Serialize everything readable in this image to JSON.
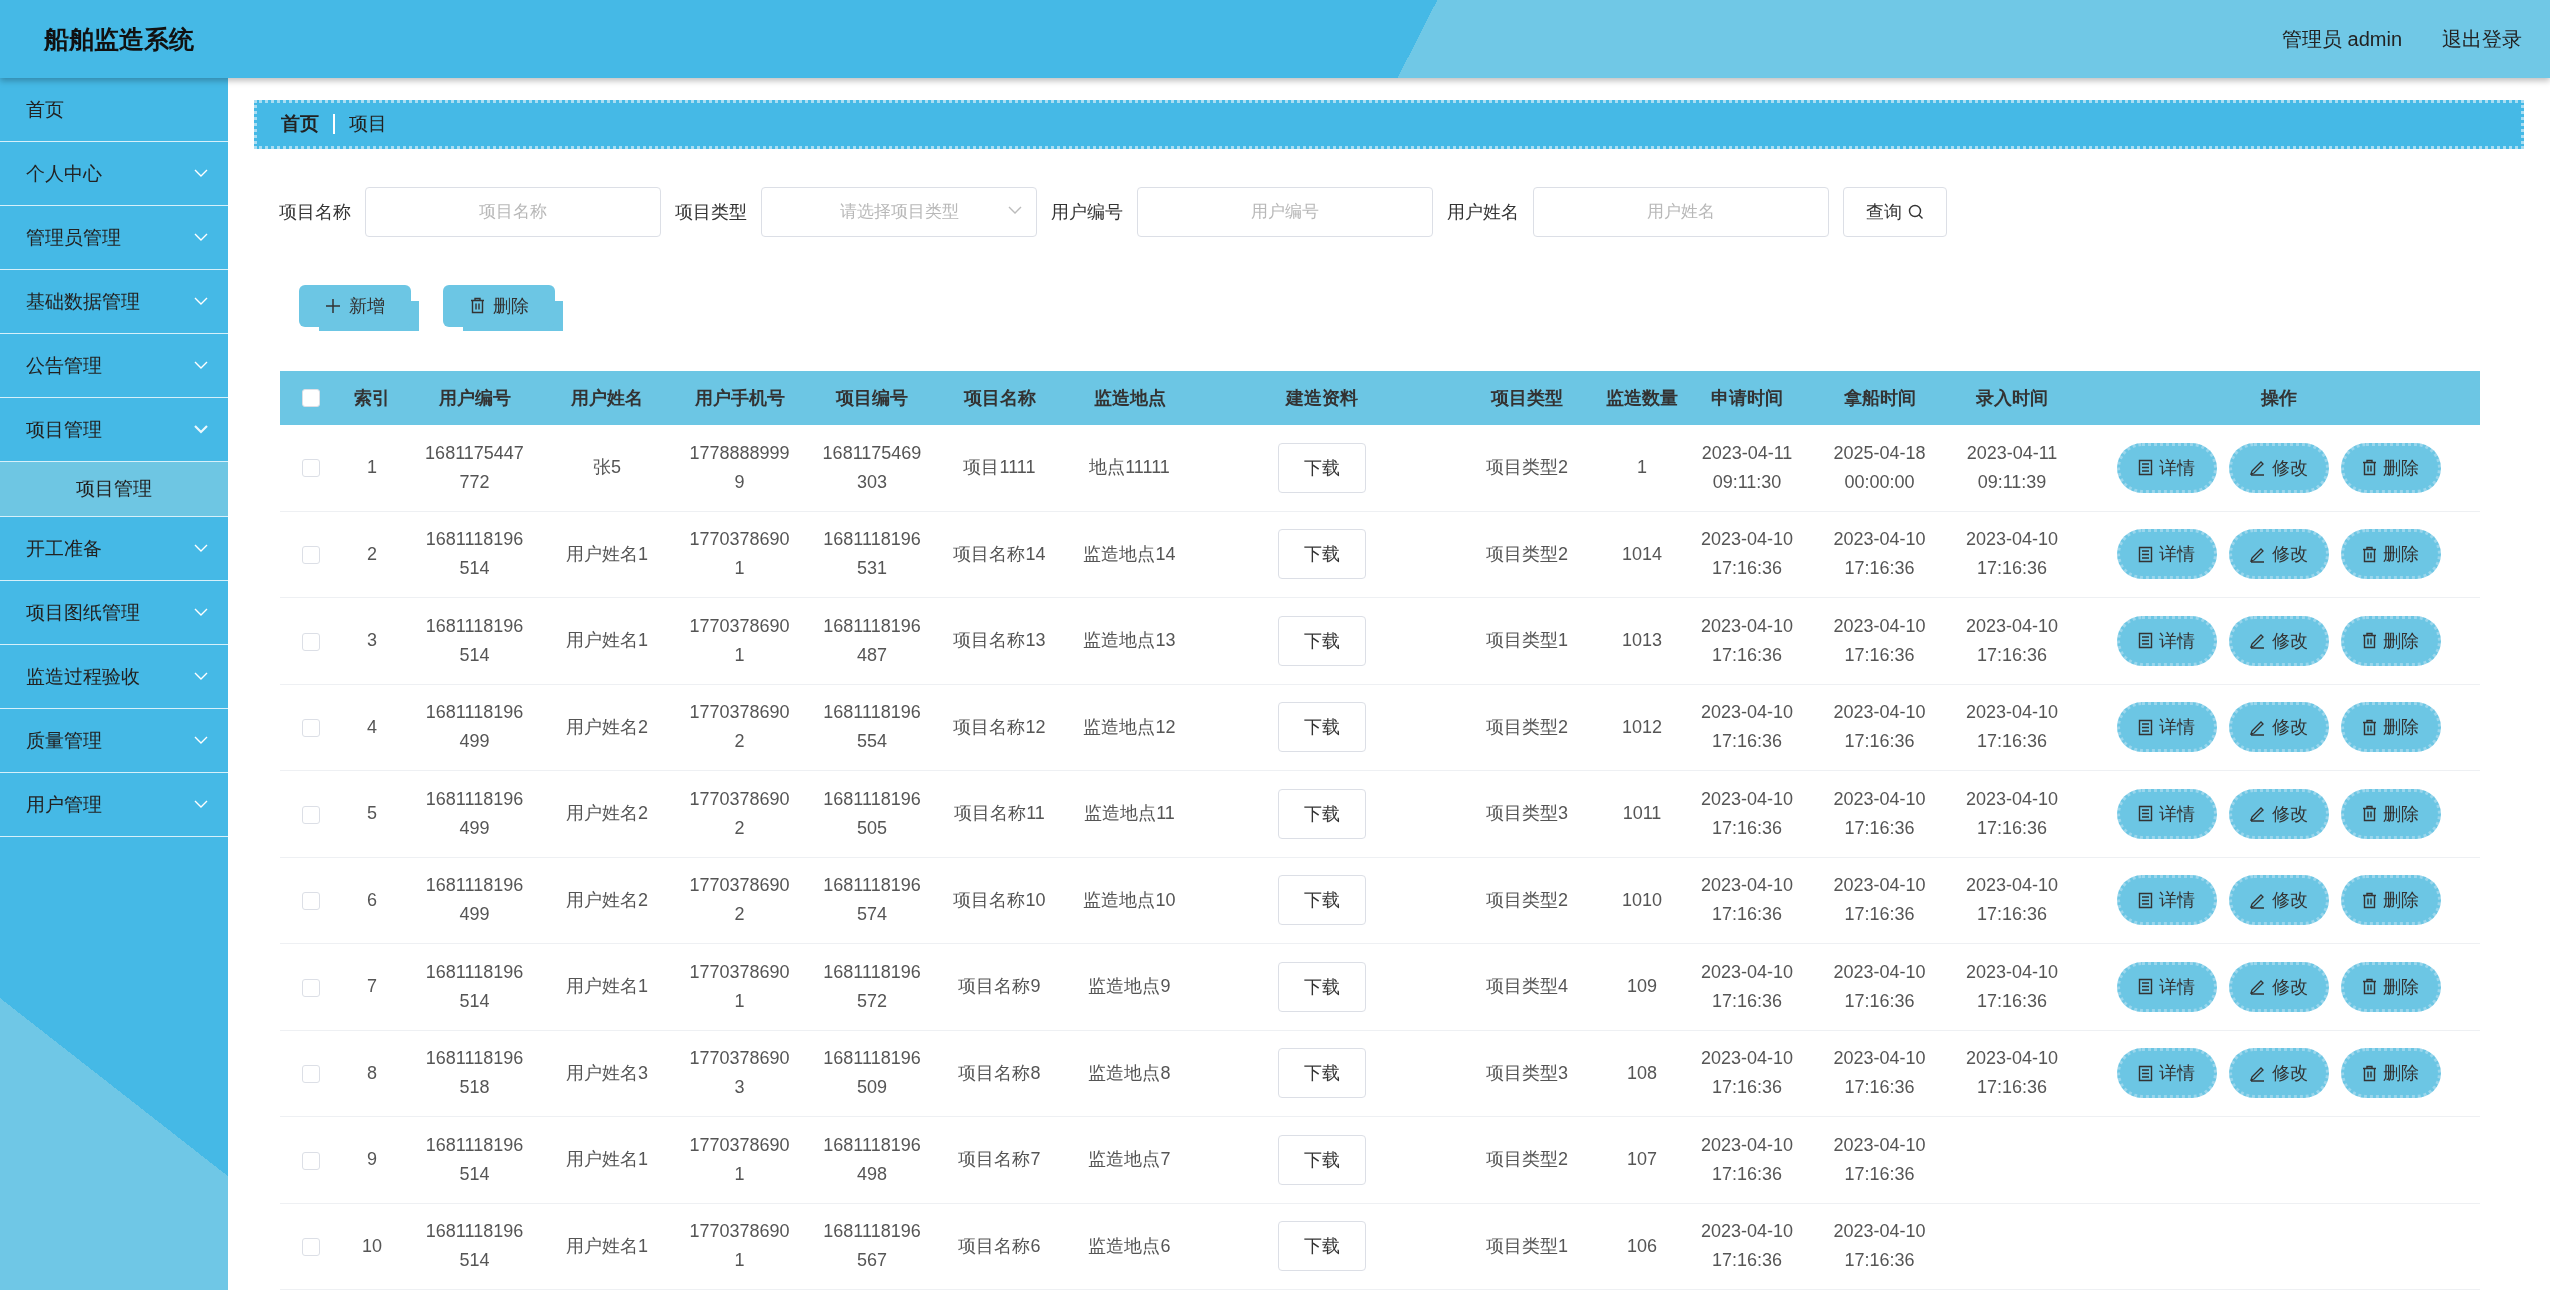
{
  "header": {
    "title": "船舶监造系统",
    "user": "管理员 admin",
    "logout": "退出登录"
  },
  "sidebar": {
    "items": [
      {
        "label": "首页",
        "kind": "link"
      },
      {
        "label": "个人中心",
        "kind": "menu",
        "expanded": false
      },
      {
        "label": "管理员管理",
        "kind": "menu",
        "expanded": false
      },
      {
        "label": "基础数据管理",
        "kind": "menu",
        "expanded": false
      },
      {
        "label": "公告管理",
        "kind": "menu",
        "expanded": false
      },
      {
        "label": "项目管理",
        "kind": "menu",
        "expanded": true,
        "children": [
          {
            "label": "项目管理",
            "selected": true
          }
        ]
      },
      {
        "label": "开工准备",
        "kind": "menu",
        "expanded": false
      },
      {
        "label": "项目图纸管理",
        "kind": "menu",
        "expanded": false
      },
      {
        "label": "监造过程验收",
        "kind": "menu",
        "expanded": false
      },
      {
        "label": "质量管理",
        "kind": "menu",
        "expanded": false
      },
      {
        "label": "用户管理",
        "kind": "menu",
        "expanded": false
      }
    ]
  },
  "breadcrumb": [
    "首页",
    "项目"
  ],
  "search": {
    "fields": [
      {
        "label": "项目名称",
        "kind": "input",
        "placeholder": "项目名称"
      },
      {
        "label": "项目类型",
        "kind": "select",
        "placeholder": "请选择项目类型"
      },
      {
        "label": "用户编号",
        "kind": "input",
        "placeholder": "用户编号"
      },
      {
        "label": "用户姓名",
        "kind": "input",
        "placeholder": "用户姓名"
      }
    ],
    "button": "查询"
  },
  "toolbar": [
    {
      "label": "新增",
      "kind": "add"
    },
    {
      "label": "删除",
      "kind": "delete"
    }
  ],
  "table": {
    "all_checked": false,
    "columns": [
      "索引",
      "用户编号",
      "用户姓名",
      "用户手机号",
      "项目编号",
      "项目名称",
      "监造地点",
      "建造资料",
      "项目类型",
      "监造数量",
      "申请时间",
      "拿船时间",
      "录入时间",
      "操作"
    ],
    "rows": [
      {
        "checked": false,
        "cells": [
          "1",
          "1681175447772",
          "张5",
          "17788889999",
          "1681175469303",
          "项目1111",
          "地点11111",
          "下载",
          "项目类型2",
          "1",
          "2023-04-11 09:11:30",
          "2025-04-18 00:00:00",
          "2023-04-11 09:11:39"
        ],
        "actions": [
          {
            "label": "详情",
            "kind": "detail"
          },
          {
            "label": "修改",
            "kind": "edit"
          },
          {
            "label": "删除",
            "kind": "delete"
          }
        ]
      },
      {
        "checked": false,
        "cells": [
          "2",
          "1681118196514",
          "用户姓名1",
          "17703786901",
          "1681118196531",
          "项目名称14",
          "监造地点14",
          "下载",
          "项目类型2",
          "1014",
          "2023-04-10 17:16:36",
          "2023-04-10 17:16:36",
          "2023-04-10 17:16:36"
        ],
        "actions": [
          {
            "label": "详情",
            "kind": "detail"
          },
          {
            "label": "修改",
            "kind": "edit"
          },
          {
            "label": "删除",
            "kind": "delete"
          }
        ]
      },
      {
        "checked": false,
        "cells": [
          "3",
          "1681118196514",
          "用户姓名1",
          "17703786901",
          "1681118196487",
          "项目名称13",
          "监造地点13",
          "下载",
          "项目类型1",
          "1013",
          "2023-04-10 17:16:36",
          "2023-04-10 17:16:36",
          "2023-04-10 17:16:36"
        ],
        "actions": [
          {
            "label": "详情",
            "kind": "detail"
          },
          {
            "label": "修改",
            "kind": "edit"
          },
          {
            "label": "删除",
            "kind": "delete"
          }
        ]
      },
      {
        "checked": false,
        "cells": [
          "4",
          "1681118196499",
          "用户姓名2",
          "17703786902",
          "1681118196554",
          "项目名称12",
          "监造地点12",
          "下载",
          "项目类型2",
          "1012",
          "2023-04-10 17:16:36",
          "2023-04-10 17:16:36",
          "2023-04-10 17:16:36"
        ],
        "actions": [
          {
            "label": "详情",
            "kind": "detail"
          },
          {
            "label": "修改",
            "kind": "edit"
          },
          {
            "label": "删除",
            "kind": "delete"
          }
        ]
      },
      {
        "checked": false,
        "cells": [
          "5",
          "1681118196499",
          "用户姓名2",
          "17703786902",
          "1681118196505",
          "项目名称11",
          "监造地点11",
          "下载",
          "项目类型3",
          "1011",
          "2023-04-10 17:16:36",
          "2023-04-10 17:16:36",
          "2023-04-10 17:16:36"
        ],
        "actions": [
          {
            "label": "详情",
            "kind": "detail"
          },
          {
            "label": "修改",
            "kind": "edit"
          },
          {
            "label": "删除",
            "kind": "delete"
          }
        ]
      },
      {
        "checked": false,
        "cells": [
          "6",
          "1681118196499",
          "用户姓名2",
          "17703786902",
          "1681118196574",
          "项目名称10",
          "监造地点10",
          "下载",
          "项目类型2",
          "1010",
          "2023-04-10 17:16:36",
          "2023-04-10 17:16:36",
          "2023-04-10 17:16:36"
        ],
        "actions": [
          {
            "label": "详情",
            "kind": "detail"
          },
          {
            "label": "修改",
            "kind": "edit"
          },
          {
            "label": "删除",
            "kind": "delete"
          }
        ]
      },
      {
        "checked": false,
        "cells": [
          "7",
          "1681118196514",
          "用户姓名1",
          "17703786901",
          "1681118196572",
          "项目名称9",
          "监造地点9",
          "下载",
          "项目类型4",
          "109",
          "2023-04-10 17:16:36",
          "2023-04-10 17:16:36",
          "2023-04-10 17:16:36"
        ],
        "actions": [
          {
            "label": "详情",
            "kind": "detail"
          },
          {
            "label": "修改",
            "kind": "edit"
          },
          {
            "label": "删除",
            "kind": "delete"
          }
        ]
      },
      {
        "checked": false,
        "cells": [
          "8",
          "1681118196518",
          "用户姓名3",
          "17703786903",
          "1681118196509",
          "项目名称8",
          "监造地点8",
          "下载",
          "项目类型3",
          "108",
          "2023-04-10 17:16:36",
          "2023-04-10 17:16:36",
          "2023-04-10 17:16:36"
        ],
        "actions": [
          {
            "label": "详情",
            "kind": "detail"
          },
          {
            "label": "修改",
            "kind": "edit"
          },
          {
            "label": "删除",
            "kind": "delete"
          }
        ]
      },
      {
        "checked": false,
        "cells": [
          "9",
          "1681118196514",
          "用户姓名1",
          "17703786901",
          "1681118196498",
          "项目名称7",
          "监造地点7",
          "下载",
          "项目类型2",
          "107",
          "2023-04-10 17:16:36",
          "2023-04-10 17:16:36"
        ],
        "actions": []
      },
      {
        "checked": false,
        "cells": [
          "10",
          "1681118196514",
          "用户姓名1",
          "17703786901",
          "1681118196567",
          "项目名称6",
          "监造地点6",
          "下载",
          "项目类型1",
          "106",
          "2023-04-10 17:16:36",
          "2023-04-10 17:16:36"
        ],
        "actions": []
      }
    ]
  }
}
